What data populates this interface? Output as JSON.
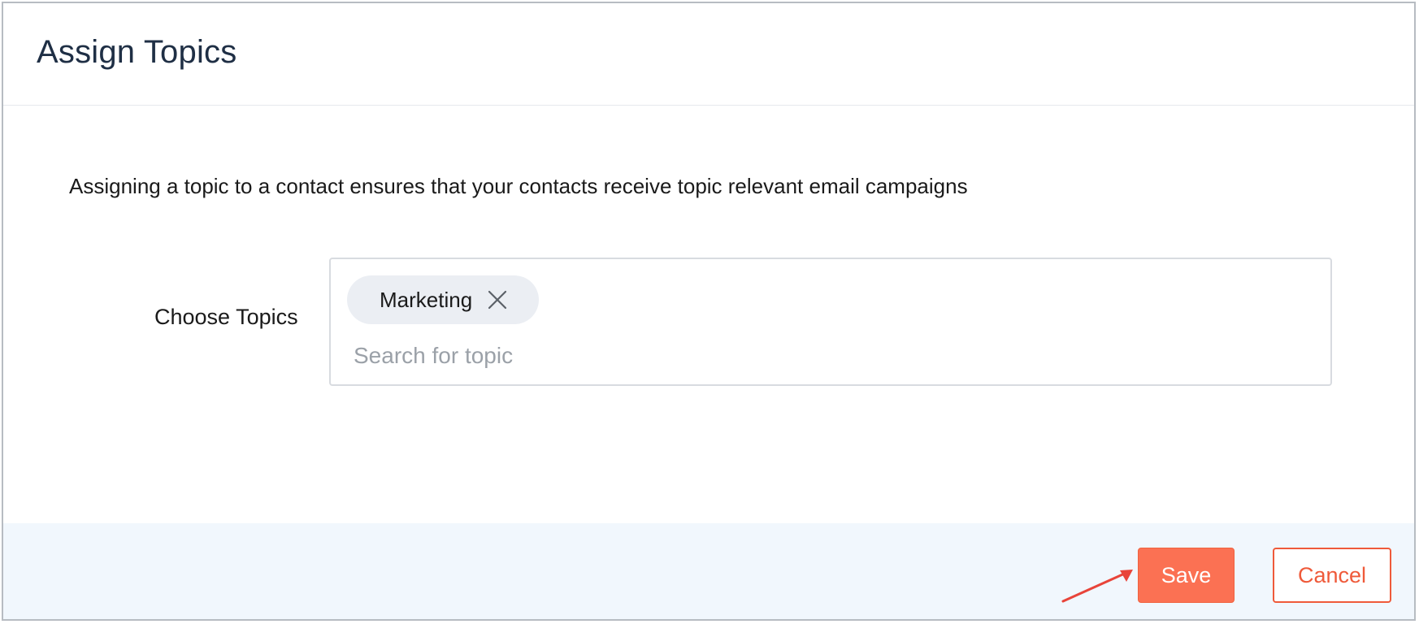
{
  "dialog": {
    "title": "Assign Topics",
    "description": "Assigning a topic to a contact ensures that your contacts receive topic relevant email campaigns"
  },
  "topics_field": {
    "label": "Choose Topics",
    "selected": [
      {
        "label": "Marketing",
        "remove_icon": "close-icon"
      }
    ],
    "search_value": "",
    "search_placeholder": "Search for topic"
  },
  "footer": {
    "save_label": "Save",
    "cancel_label": "Cancel"
  },
  "annotation": {
    "arrow_color": "#e8443a"
  },
  "colors": {
    "accent": "#fb7153",
    "cancel_text": "#ef5a3a",
    "footer_bg": "#f1f7fd",
    "chip_bg": "#ebeef3"
  }
}
